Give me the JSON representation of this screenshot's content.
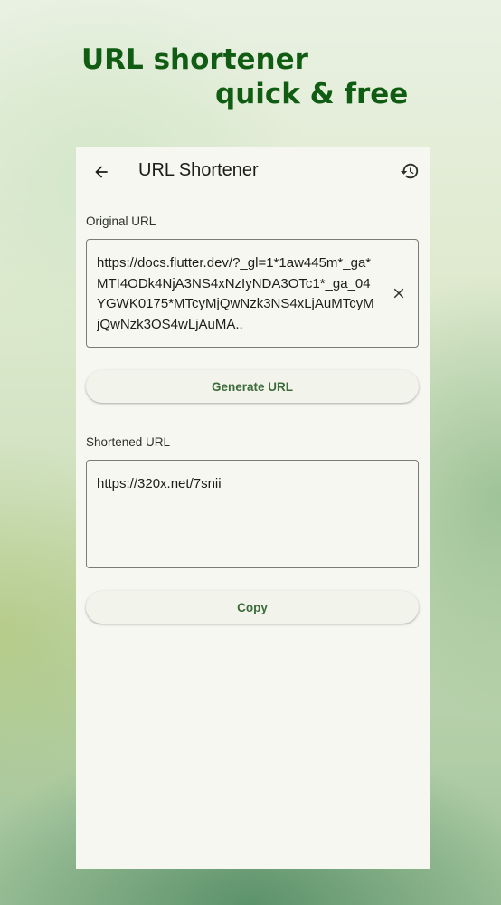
{
  "promo": {
    "line1": "URL shortener",
    "line2": "quick & free"
  },
  "appbar": {
    "title": "URL Shortener",
    "back_icon": "arrow-back-icon",
    "history_icon": "history-icon"
  },
  "original": {
    "label": "Original URL",
    "value": "https://docs.flutter.dev/?_gl=1*1aw445m*_ga*MTI4ODk4NjA3NS4xNzIyNDA3OTc1*_ga_04YGWK0175*MTcyMjQwNzk3NS4xLjAuMTcyMjQwNzk3OS4wLjAuMA..",
    "clear_icon": "close-icon"
  },
  "generate_button": {
    "label": "Generate URL"
  },
  "shortened": {
    "label": "Shortened URL",
    "value": "https://320x.net/7snii"
  },
  "copy_button": {
    "label": "Copy"
  },
  "colors": {
    "promo_text": "#0f5c12",
    "button_text": "#3d6b3b",
    "surface": "#f6f7f1",
    "outline": "#7a7c74"
  }
}
